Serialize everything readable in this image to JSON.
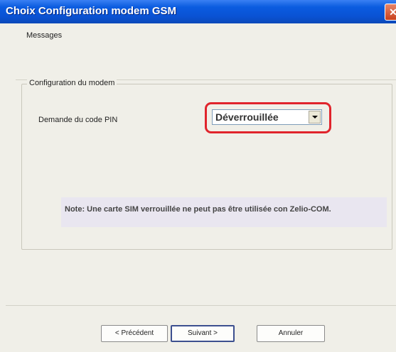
{
  "window": {
    "title": "Choix Configuration modem GSM",
    "close_symbol": "✕"
  },
  "messages_label": "Messages",
  "group": {
    "legend": "Configuration du modem",
    "pin_label": "Demande du code PIN",
    "pin_select": {
      "value": "Déverrouillée",
      "arrow_icon": "chevron-down-icon"
    },
    "note": "Note: Une carte SIM verrouillée ne peut pas être utilisée con Zelio-COM."
  },
  "buttons": {
    "previous": "< Précédent",
    "next": "Suivant >",
    "cancel": "Annuler"
  },
  "colors": {
    "titlebar": "#0a52d4",
    "highlight": "#e0242c",
    "note_bg": "#e9e6f0"
  }
}
